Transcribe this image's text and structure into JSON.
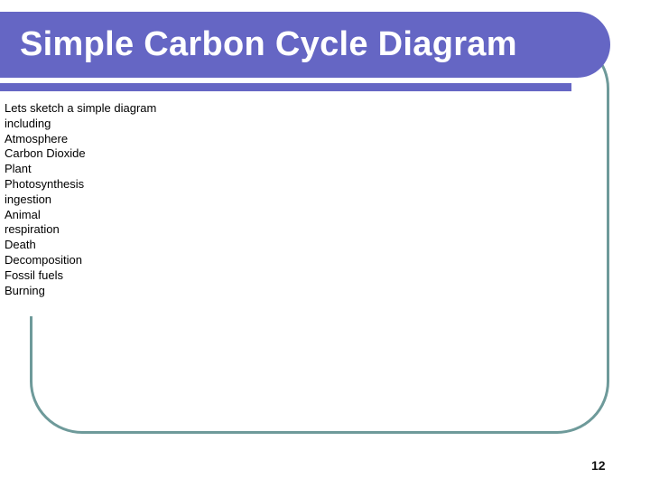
{
  "slide": {
    "title": "Simple Carbon Cycle Diagram",
    "page_number": "12",
    "colors": {
      "title_banner": "#6566C4",
      "title_text": "#FFFFFF",
      "frame_border": "#6E9A9A",
      "body_text": "#000000",
      "background": "#FFFFFF"
    },
    "body_lines": [
      "Lets sketch a simple diagram",
      "including",
      "Atmosphere",
      "Carbon Dioxide",
      "Plant",
      "Photosynthesis",
      "ingestion",
      "Animal",
      "respiration",
      "Death",
      "Decomposition",
      "Fossil fuels",
      "Burning"
    ]
  }
}
